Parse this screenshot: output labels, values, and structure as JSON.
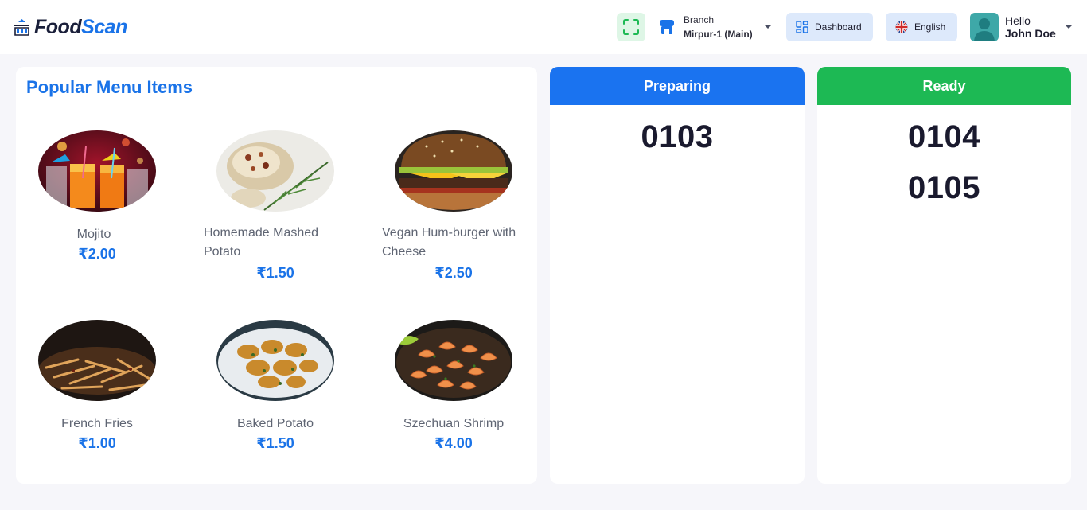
{
  "header": {
    "logo_word_1": "Food",
    "logo_word_2": "Scan",
    "branch_label": "Branch",
    "branch_value": "Mirpur-1 (Main)",
    "dashboard_label": "Dashboard",
    "language_label": "English",
    "greeting": "Hello",
    "user_name": "John Doe"
  },
  "menu": {
    "title": "Popular Menu Items",
    "items": [
      {
        "name": "Mojito",
        "price": "₹2.00",
        "image": "mojito"
      },
      {
        "name": "Homemade Mashed Potato",
        "name_line1": "Homemade Mashed",
        "name_line2": "Potato",
        "price": "₹1.50",
        "image": "mashed-potato"
      },
      {
        "name": "Vegan Hum-burger with Cheese",
        "name_line1": "Vegan Hum-burger with",
        "name_line2": "Cheese",
        "price": "₹2.50",
        "image": "burger"
      },
      {
        "name": "French Fries",
        "price": "₹1.00",
        "image": "french-fries"
      },
      {
        "name": "Baked Potato",
        "price": "₹1.50",
        "image": "baked-potato"
      },
      {
        "name": "Szechuan Shrimp",
        "price": "₹4.00",
        "image": "shrimp"
      }
    ]
  },
  "orders": {
    "preparing_title": "Preparing",
    "preparing": [
      "0103"
    ],
    "ready_title": "Ready",
    "ready": [
      "0104",
      "0105"
    ]
  },
  "colors": {
    "brand_blue": "#1a73e8",
    "preparing_header": "#1a73f0",
    "ready_header": "#1db954",
    "scan_bg": "#def6e6",
    "pill_bg": "#dde9fb"
  }
}
